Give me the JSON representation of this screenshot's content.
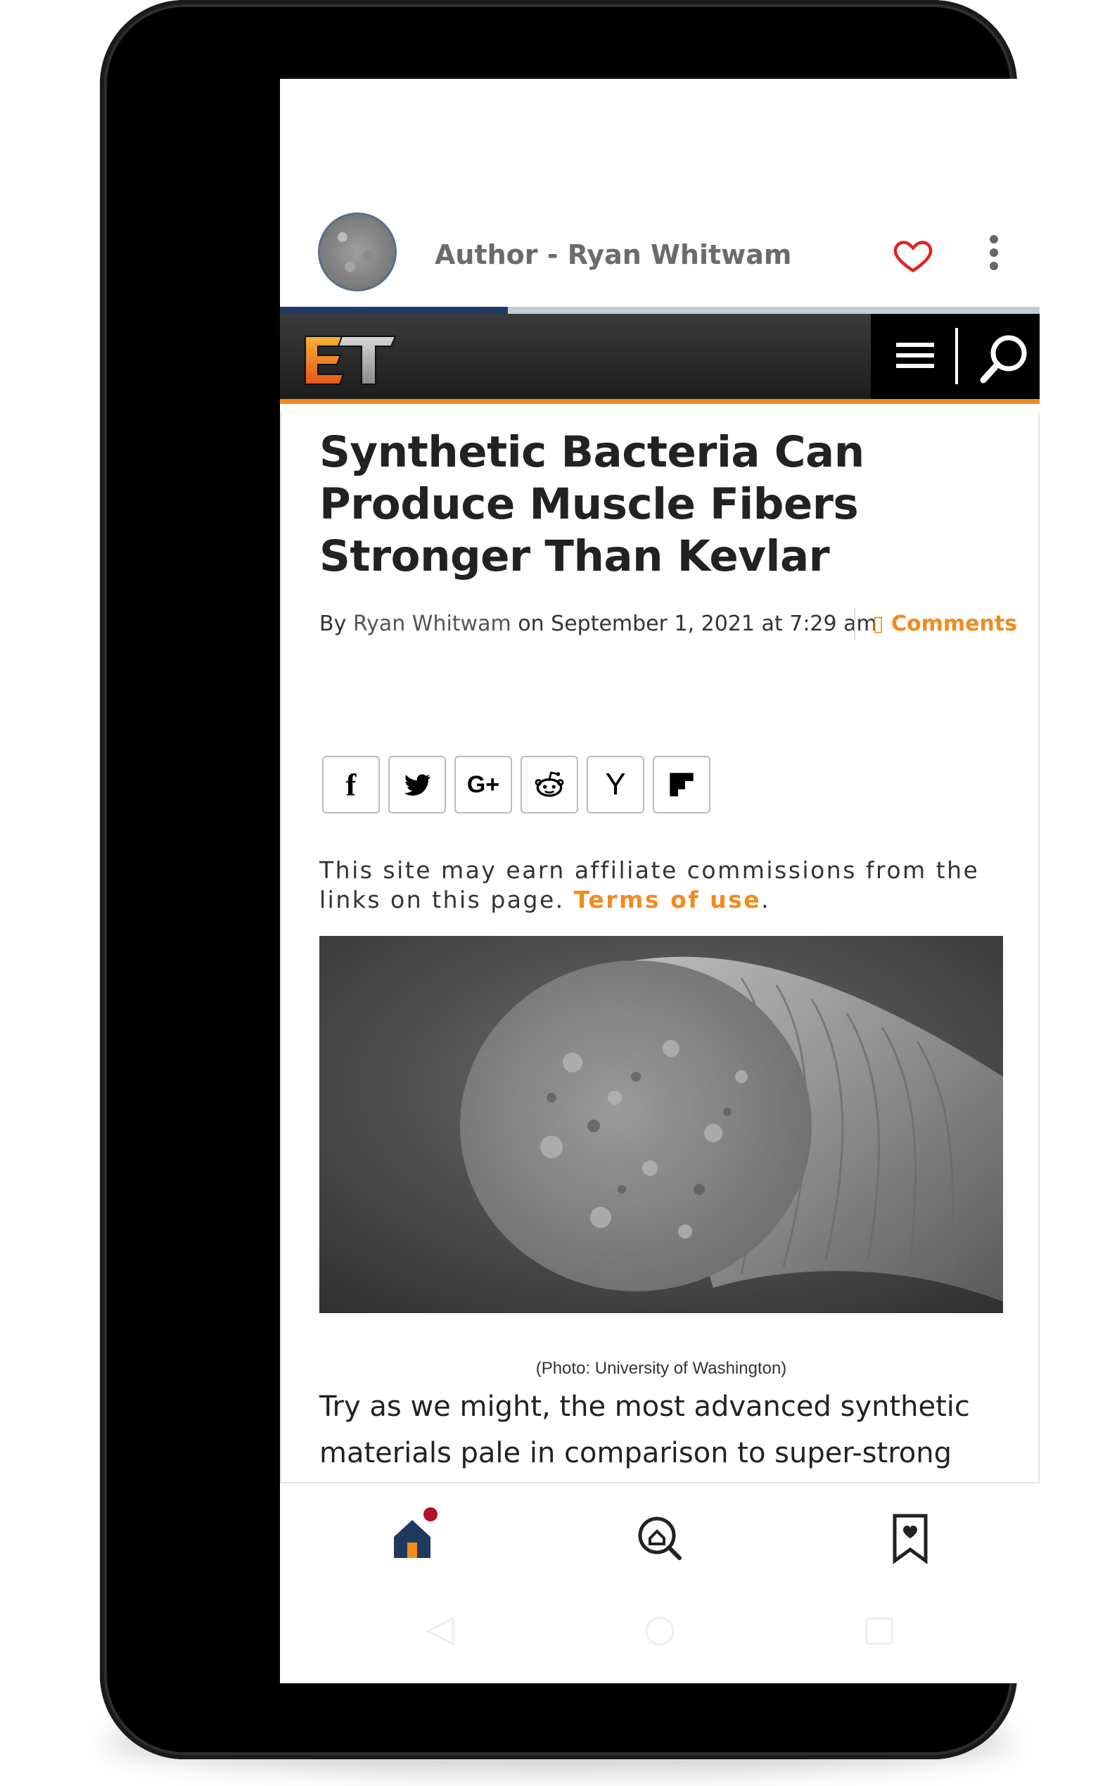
{
  "app_bar": {
    "title": "Author - Ryan Whitwam",
    "avatar_icon": "author-avatar",
    "favorite_icon": "heart-icon",
    "more_icon": "kebab-menu-icon",
    "reading_progress": 0.3
  },
  "site_header": {
    "logo_text": "ET",
    "menu_icon": "hamburger-icon",
    "search_icon": "search-icon",
    "accent_color": "#f38b1d"
  },
  "article": {
    "headline": "Synthetic Bacteria Can Produce Muscle Fibers Stronger Than Kevlar",
    "byline_prefix": "By",
    "author": "Ryan Whitwam",
    "date_text": "on September 1, 2021 at 7:29 am",
    "comments_label": "Comments",
    "share_buttons": [
      {
        "name": "facebook",
        "label": "f"
      },
      {
        "name": "twitter",
        "label": "twitter-bird"
      },
      {
        "name": "google-plus",
        "label": "G+"
      },
      {
        "name": "reddit",
        "label": "reddit-alien"
      },
      {
        "name": "hacker-news",
        "label": "Y"
      },
      {
        "name": "flipboard",
        "label": "flipboard"
      }
    ],
    "affiliate_text": "This site may earn affiliate commissions from the links on this page.",
    "terms_link": "Terms of use",
    "terms_suffix": ".",
    "image_caption": "(Photo: University of Washington)",
    "body_text": "Try as we might, the most advanced synthetic materials pale in comparison to super-strong biological compounds like spider silk and muscle"
  },
  "bottom_nav": {
    "items": [
      {
        "name": "home",
        "icon": "home-icon",
        "active": true
      },
      {
        "name": "explore",
        "icon": "explore-search-icon",
        "active": false
      },
      {
        "name": "bookmarks",
        "icon": "bookmark-heart-icon",
        "active": false
      }
    ]
  },
  "system_nav": {
    "back_icon": "back-icon",
    "home_icon": "home-circle-icon",
    "recents_icon": "recents-icon"
  }
}
